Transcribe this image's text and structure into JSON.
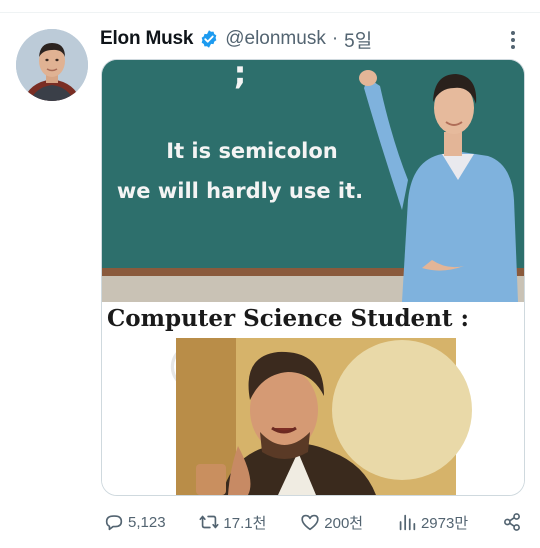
{
  "tweet": {
    "author": {
      "name": "Elon Musk",
      "handle": "@elonmusk",
      "time": "5일"
    },
    "media": {
      "chalkboard_lines": [
        "It is semicolon",
        "we will hardly use it."
      ],
      "chalkboard_symbol": ";",
      "caption": "Computer Science Student :",
      "watermark": "©"
    },
    "actions": {
      "replies": "5,123",
      "retweets": "17.1천",
      "likes": "200천",
      "views": "2973만"
    }
  },
  "colors": {
    "chalkboard": "#2d6f6c",
    "verified": "#1d9bf0",
    "muted": "#536471",
    "shirt": "#7fb2dd"
  },
  "icons": [
    "verified-badge-icon",
    "more-icon",
    "reply-icon",
    "retweet-icon",
    "like-icon",
    "views-icon",
    "share-icon"
  ]
}
